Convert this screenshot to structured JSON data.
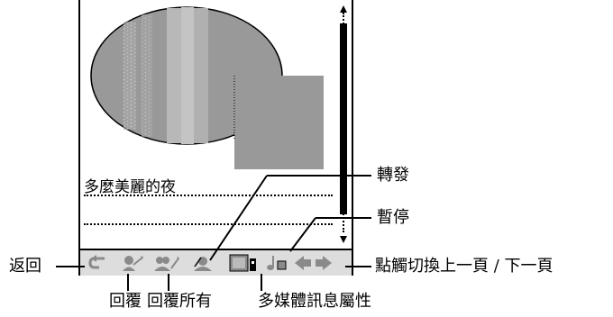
{
  "message": {
    "title": "多麼美麗的夜"
  },
  "toolbar": {
    "buttons": [
      {
        "name": "back-button",
        "icon": "back-arrow-icon"
      },
      {
        "name": "reply-button",
        "icon": "reply-icon"
      },
      {
        "name": "reply-all-button",
        "icon": "reply-all-icon"
      },
      {
        "name": "forward-button",
        "icon": "forward-icon"
      },
      {
        "name": "multimedia-properties-button",
        "icon": "multimedia-properties-icon"
      },
      {
        "name": "pause-button",
        "icon": "music-note-icon"
      },
      {
        "name": "prev-page-button",
        "icon": "arrow-left-icon"
      },
      {
        "name": "next-page-button",
        "icon": "arrow-right-icon"
      }
    ]
  },
  "callouts": {
    "back": "返回",
    "reply": "回覆",
    "reply_all": "回覆所有",
    "multimedia_properties": "多媒體訊息屬性",
    "forward": "轉發",
    "pause": "暫停",
    "page_nav": "點觸切換上一頁 / 下一頁"
  },
  "colors": {
    "toolbar_bg": "#dddddd",
    "picture_fill": "#999999",
    "icon_gray": "#8a8a8a"
  }
}
